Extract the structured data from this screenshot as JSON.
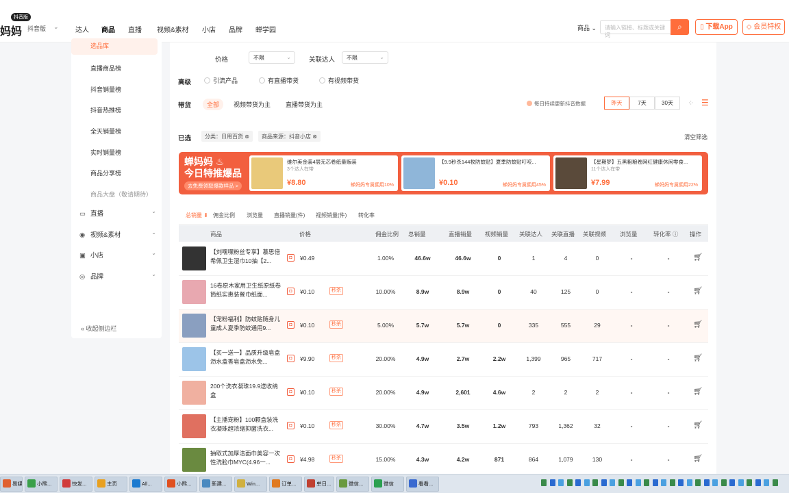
{
  "header": {
    "logo": "妈妈",
    "badge": "抖音版",
    "platform": "抖音版",
    "nav": [
      "达人",
      "商品",
      "直播",
      "视频&素材",
      "小店",
      "品牌",
      "蝉学园"
    ],
    "search_category": "商品",
    "search_placeholder": "请输入链接、标题或关键词",
    "download": "下载App",
    "vip": "会员特权"
  },
  "sidebar": {
    "active": "选品库",
    "items": [
      "直播商品榜",
      "抖音销量榜",
      "抖音热推榜",
      "全天销量榜",
      "实时销量榜",
      "商品分享榜",
      "商品大盘（敬请期待）"
    ],
    "groups": [
      "直播",
      "视频&素材",
      "小店",
      "品牌"
    ],
    "collapse": "收起侧边栏"
  },
  "filters": {
    "price_label": "价格",
    "price_value": "不限",
    "expert_label": "关联达人",
    "expert_value": "不限",
    "advanced_label": "高级",
    "advanced_opts": [
      "引流产品",
      "有直播带货",
      "有视频带货"
    ],
    "sell_label": "带货",
    "sell_opts": [
      "全部",
      "视频带货为主",
      "直播带货为主"
    ],
    "update_note": "每日持续更新抖音数据",
    "time_opts": [
      "昨天",
      "7天",
      "30天"
    ],
    "selected_label": "已选",
    "chips": [
      "分类：日用百货",
      "商品来源：抖音小店"
    ],
    "clear": "清空筛选"
  },
  "banner": {
    "title1": "蝉妈妈",
    "title2": "今日特推爆品",
    "sub": "去免费领取爆款样品 >",
    "cards": [
      {
        "title": "维尔美金装4层无芯卷纸量贩装",
        "meta": "3个达人在带",
        "price": "¥8.80",
        "comm": "蝉妈妈专属佣用10%",
        "color": "#e9c97a"
      },
      {
        "title": "【9.9秒杀144枚防蚊贴】夏季防蚊贴叮咬...",
        "meta": "",
        "price": "¥0.10",
        "comm": "蝉妈妈专属佣用45%",
        "color": "#8fb6d9"
      },
      {
        "title": "【星期梦】五黑粗粮卷网红健康休闲零食...",
        "meta": "11个达人在带",
        "price": "¥7.99",
        "comm": "蝉妈妈专属佣用22%",
        "color": "#5a4a3a"
      }
    ]
  },
  "tabs": [
    "总销量",
    "佣金比例",
    "浏览量",
    "直播销量(件)",
    "视频销量(件)",
    "转化率"
  ],
  "columns": [
    "商品",
    "价格",
    "佣金比例",
    "总销量",
    "直播销量",
    "视频销量",
    "关联达人",
    "关联直播",
    "关联视频",
    "浏览量",
    "转化率",
    "操作"
  ],
  "rows": [
    {
      "name": "【刘嘿嘿粉丝专享】慕思倍希佩卫生湿巾10抽【2...",
      "price": "¥0.49",
      "tag": "",
      "comm": "1.00%",
      "total": "46.6w",
      "live": "46.6w",
      "video": "0",
      "experts": "1",
      "lives": "4",
      "videos": "0",
      "views": "-",
      "conv": "-",
      "color": "#333"
    },
    {
      "name": "16卷原木家用卫生纸原纸卷筒纸实惠装餐巾纸面...",
      "price": "¥0.10",
      "tag": "秒杀",
      "comm": "10.00%",
      "total": "8.9w",
      "live": "8.9w",
      "video": "0",
      "experts": "40",
      "lives": "125",
      "videos": "0",
      "views": "-",
      "conv": "-",
      "color": "#e8a8b0"
    },
    {
      "name": "【宠粉福利】防蚊贴随身儿童成人夏季防蚊通用9...",
      "price": "¥0.10",
      "tag": "秒杀",
      "comm": "5.00%",
      "total": "5.7w",
      "live": "5.7w",
      "video": "0",
      "experts": "335",
      "lives": "555",
      "videos": "29",
      "views": "-",
      "conv": "-",
      "color": "#8a9fc0"
    },
    {
      "name": "【买一送一】品质升级皂盒沥水盒香皂盒沥水免...",
      "price": "¥9.90",
      "tag": "秒杀",
      "comm": "20.00%",
      "total": "4.9w",
      "live": "2.7w",
      "video": "2.2w",
      "experts": "1,399",
      "lives": "965",
      "videos": "717",
      "views": "-",
      "conv": "-",
      "color": "#9cc4e8"
    },
    {
      "name": "200个洗衣凝珠19.9送收纳盒",
      "price": "¥0.10",
      "tag": "秒杀",
      "comm": "20.00%",
      "total": "4.9w",
      "live": "2,601",
      "video": "4.6w",
      "experts": "2",
      "lives": "2",
      "videos": "2",
      "views": "-",
      "conv": "-",
      "color": "#f0b0a0"
    },
    {
      "name": "【主播宠粉】100颗盒装洗衣凝珠超浓缩抑菌洗衣...",
      "price": "¥0.10",
      "tag": "秒杀",
      "comm": "30.00%",
      "total": "4.7w",
      "live": "3.5w",
      "video": "1.2w",
      "experts": "793",
      "lives": "1,362",
      "videos": "32",
      "views": "-",
      "conv": "-",
      "color": "#e07060"
    },
    {
      "name": "抽取式加厚洁面巾美容一次性洗脸巾MYC(4.96一...",
      "price": "¥4.98",
      "tag": "秒杀",
      "comm": "15.00%",
      "total": "4.3w",
      "live": "4.2w",
      "video": "871",
      "experts": "864",
      "lives": "1,079",
      "videos": "130",
      "views": "-",
      "conv": "-",
      "color": "#6a8a40"
    }
  ],
  "taskbar": [
    "易媒...",
    "小熊...",
    "快发...",
    "主页",
    "All...",
    "小熊...",
    "新建...",
    "Win...",
    "订单...",
    "单日...",
    "微信...",
    "微信",
    "看看..."
  ]
}
